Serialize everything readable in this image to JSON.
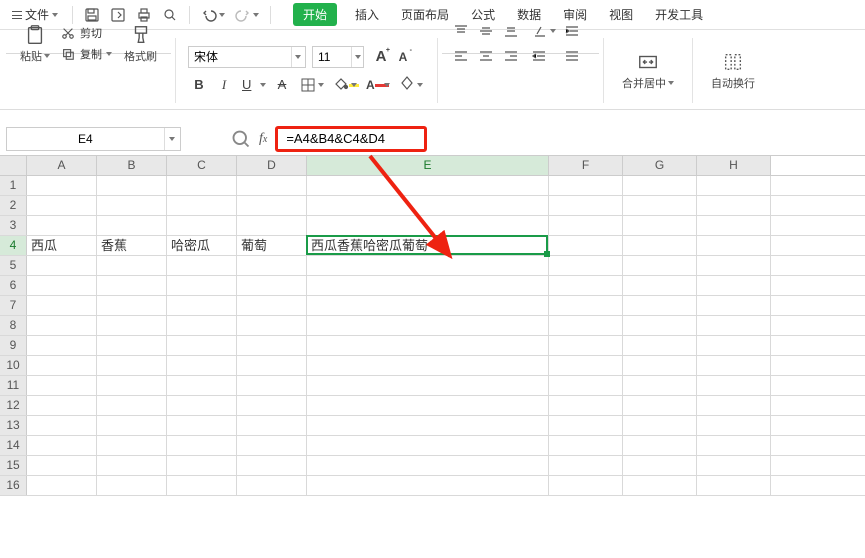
{
  "menu": {
    "file": "文件"
  },
  "tabs": [
    "开始",
    "插入",
    "页面布局",
    "公式",
    "数据",
    "审阅",
    "视图",
    "开发工具"
  ],
  "activeTab": 0,
  "clipboard": {
    "paste": "粘贴",
    "cut": "剪切",
    "copy": "复制",
    "format_painter": "格式刷"
  },
  "font": {
    "name": "宋体",
    "size": "11",
    "increase_tip": "A+",
    "decrease_tip": "A-"
  },
  "merge": {
    "label": "合并居中"
  },
  "wrap": {
    "label": "自动换行"
  },
  "name_box": "E4",
  "formula": "=A4&B4&C4&D4",
  "columns": [
    "A",
    "B",
    "C",
    "D",
    "E",
    "F",
    "G",
    "H"
  ],
  "col_widths": [
    "wA",
    "wB",
    "wC",
    "wD",
    "wE",
    "wF",
    "wG",
    "wH"
  ],
  "row_count": 16,
  "selected": {
    "row": 4,
    "col": "E"
  },
  "cells": {
    "4": {
      "A": "西瓜",
      "B": "香蕉",
      "C": "哈密瓜",
      "D": "葡萄",
      "E": "西瓜香蕉哈密瓜葡萄"
    }
  }
}
